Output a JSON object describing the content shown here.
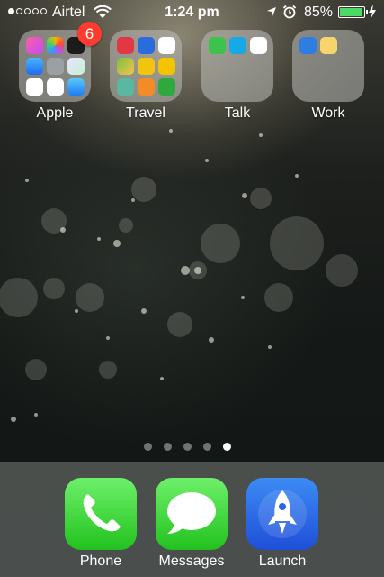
{
  "status_bar": {
    "signal_filled": 1,
    "signal_total": 5,
    "carrier": "Airtel",
    "time": "1:24 pm",
    "battery_percent": "85%",
    "battery_level": 0.85,
    "charging": true
  },
  "folders": [
    {
      "label": "Apple",
      "badge": "6",
      "icons": [
        "music-icon",
        "photos-icon",
        "stocks-icon",
        "safari-icon",
        "contacts-icon",
        "game-center-icon",
        "calendar-icon",
        "voice-memos-icon",
        "mail-icon"
      ]
    },
    {
      "label": "Travel",
      "icons": [
        "zomato-icon",
        "foursquare-icon",
        "uber-icon",
        "maps-icon",
        "circle-app-icon",
        "taxi-icon",
        "wallet-icon",
        "checkmark-app-icon",
        "flight-icon"
      ]
    },
    {
      "label": "Talk",
      "icons": [
        "whatsapp-icon",
        "skype-icon",
        "gmail-icon"
      ]
    },
    {
      "label": "Work",
      "icons": [
        "trello-icon",
        "calendar-grid-icon"
      ]
    }
  ],
  "page_indicator": {
    "count": 5,
    "active": 4
  },
  "dock": [
    {
      "label": "Phone",
      "icon": "phone-icon"
    },
    {
      "label": "Messages",
      "icon": "messages-icon"
    },
    {
      "label": "Launch",
      "icon": "rocket-icon"
    }
  ]
}
